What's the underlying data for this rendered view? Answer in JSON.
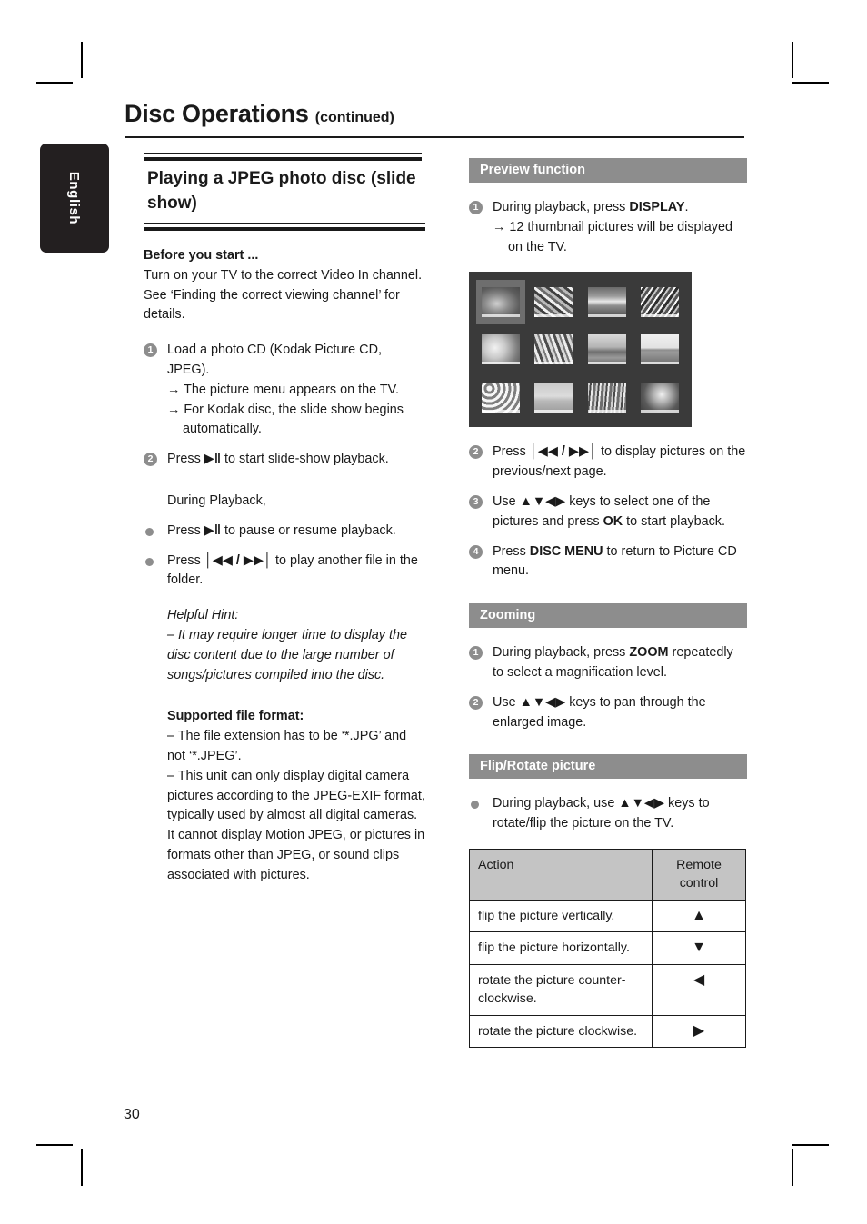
{
  "page": {
    "title_main": "Disc Operations",
    "title_suffix": "(continued)",
    "language_tab": "English",
    "page_number": "30"
  },
  "left_column": {
    "section_heading": "Playing a JPEG photo disc (slide show)",
    "before_you_start": {
      "heading": "Before you start ...",
      "body": "Turn on your TV to the correct Video In channel. See ‘Finding the correct viewing channel’ for details."
    },
    "steps": [
      {
        "num": "1",
        "text": "Load a photo CD (Kodak Picture CD, JPEG).",
        "results": [
          "The picture menu appears on the TV.",
          "For Kodak disc, the slide show begins automatically."
        ]
      },
      {
        "num": "2",
        "text_before": "Press ",
        "key": "▶‖",
        "text_after": " to start slide-show playback.",
        "results": []
      }
    ],
    "during_playback_label": "During Playback,",
    "bullets": [
      {
        "text_before": "Press ",
        "key": "▶‖",
        "text_after": " to pause or resume playback."
      },
      {
        "text_before": "Press ",
        "key": "│◀◀ / ▶▶│",
        "text_after": " to play another file in the folder."
      }
    ],
    "helpful_hint": {
      "label": "Helpful Hint:",
      "text": "–  It may require longer time to display the disc content due to the large number of songs/pictures compiled into the disc."
    },
    "supported_file_format": {
      "heading": "Supported file format:",
      "items": [
        "–  The file extension has to be ‘*.JPG’ and not ‘*.JPEG’.",
        "–  This unit can only display digital camera pictures according to the JPEG-EXIF format, typically used by almost all digital cameras. It cannot display Motion JPEG, or pictures in formats other than JPEG, or sound clips associated with pictures."
      ]
    }
  },
  "right_column": {
    "preview": {
      "bar_label": "Preview function",
      "steps": [
        {
          "num": "1",
          "text_before": "During playback, press ",
          "key": "DISPLAY",
          "text_after": ".",
          "result": "12 thumbnail pictures will be displayed on the TV."
        },
        {
          "num": "2",
          "text_before": "Press ",
          "key": "│◀◀ / ▶▶│",
          "text_after": " to display pictures on the previous/next page."
        },
        {
          "num": "3",
          "text_before": "Use ",
          "key": "▲▼◀▶",
          "text_mid": " keys to select one of the pictures and press ",
          "key2": "OK",
          "text_after": " to start playback."
        },
        {
          "num": "4",
          "text_before": "Press ",
          "key": "DISC MENU",
          "text_after": " to return to Picture CD menu."
        }
      ],
      "tv_screen": {
        "thumbnail_count": 12,
        "rows": 3,
        "columns": 4,
        "selected_index": 1
      }
    },
    "zooming": {
      "bar_label": "Zooming",
      "steps": [
        {
          "num": "1",
          "text_before": "During playback, press ",
          "key": "ZOOM",
          "text_after": " repeatedly to select a magnification level."
        },
        {
          "num": "2",
          "text_before": "Use ",
          "key": "▲▼◀▶",
          "text_after": " keys to pan through the enlarged image."
        }
      ]
    },
    "flip_rotate": {
      "bar_label": "Flip/Rotate picture",
      "bullet": {
        "text_before": "During playback, use ",
        "key": "▲▼◀▶",
        "text_after": " keys to rotate/flip the picture on the TV."
      },
      "table": {
        "headers": [
          "Action",
          "Remote control"
        ],
        "rows": [
          {
            "action": "flip the picture vertically.",
            "control": "▲"
          },
          {
            "action": "flip the picture horizontally.",
            "control": "▼"
          },
          {
            "action": "rotate the picture counter-clockwise.",
            "control": "◀"
          },
          {
            "action": "rotate the picture clockwise.",
            "control": "▶"
          }
        ]
      }
    }
  },
  "colors": {
    "bar_gray": "#8d8d8d",
    "table_header_gray": "#c4c4c4",
    "tab_black": "#231f20",
    "tv_background": "#3a3a3a"
  }
}
